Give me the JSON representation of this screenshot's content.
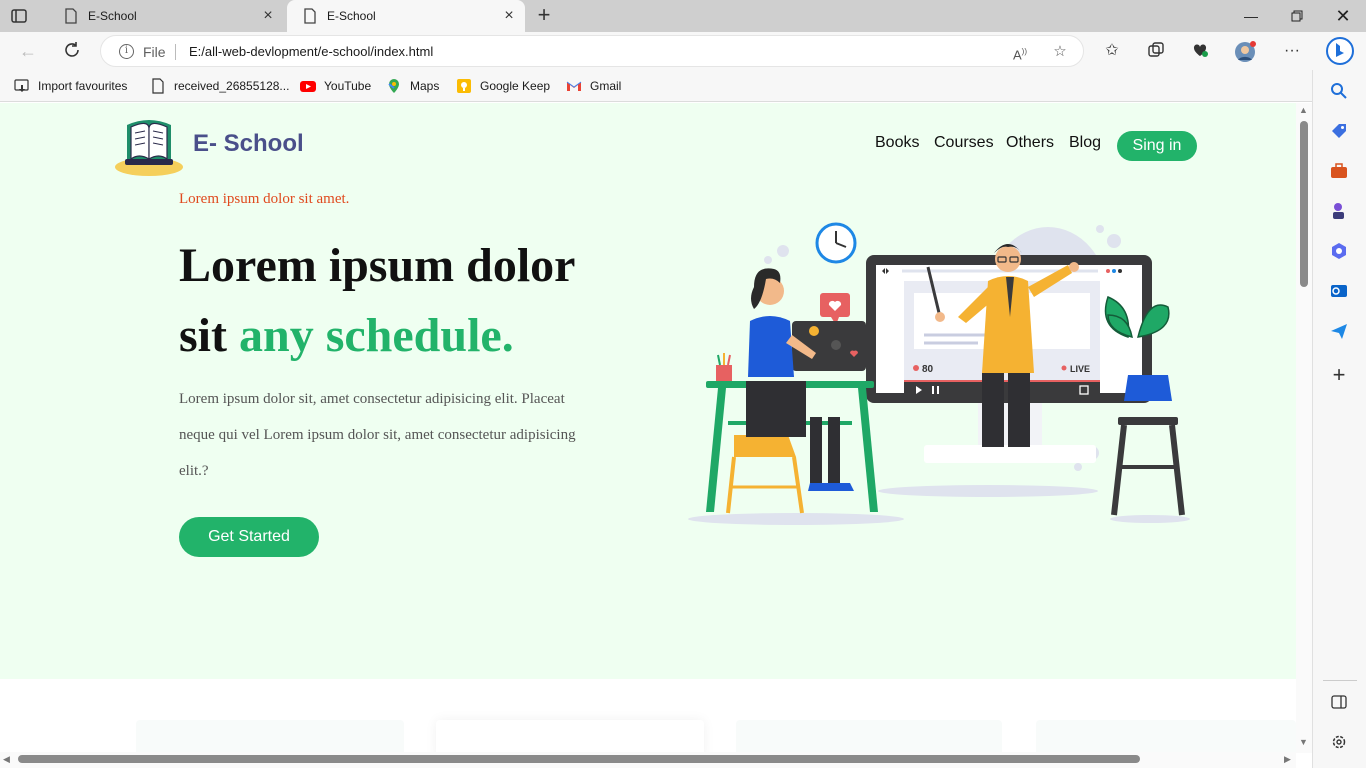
{
  "browser": {
    "tabs": [
      {
        "title": "E-School",
        "active": false
      },
      {
        "title": "E-School",
        "active": true
      }
    ],
    "address": {
      "scheme_label": "File",
      "url": "E:/all-web-devlopment/e-school/index.html"
    },
    "favourites": [
      {
        "label": "Import favourites",
        "icon": "import-icon"
      },
      {
        "label": "received_26855128...",
        "icon": "file-icon"
      },
      {
        "label": "YouTube",
        "icon": "youtube-icon"
      },
      {
        "label": "Maps",
        "icon": "maps-icon"
      },
      {
        "label": "Google Keep",
        "icon": "keep-icon"
      },
      {
        "label": "Gmail",
        "icon": "gmail-icon"
      }
    ]
  },
  "site": {
    "brand": "E- School",
    "nav": [
      "Books",
      "Courses",
      "Others",
      "Blog"
    ],
    "signin_label": "Sing in",
    "kicker": "Lorem ipsum dolor sit amet.",
    "headline_part1": "Lorem ipsum dolor sit ",
    "headline_accent": "any schedule.",
    "paragraph": "Lorem ipsum dolor sit, amet consectetur adipisicing elit. Placeat neque qui vel Lorem ipsum dolor sit, amet consectetur adipisicing elit.?",
    "cta_label": "Get Started",
    "illustration": {
      "viewer_count": "80",
      "live_label": "LIVE"
    }
  },
  "colors": {
    "accent": "#22b36a",
    "kicker": "#e04a1f",
    "brand": "#4a4f8a",
    "hero_bg": "#effff1"
  }
}
